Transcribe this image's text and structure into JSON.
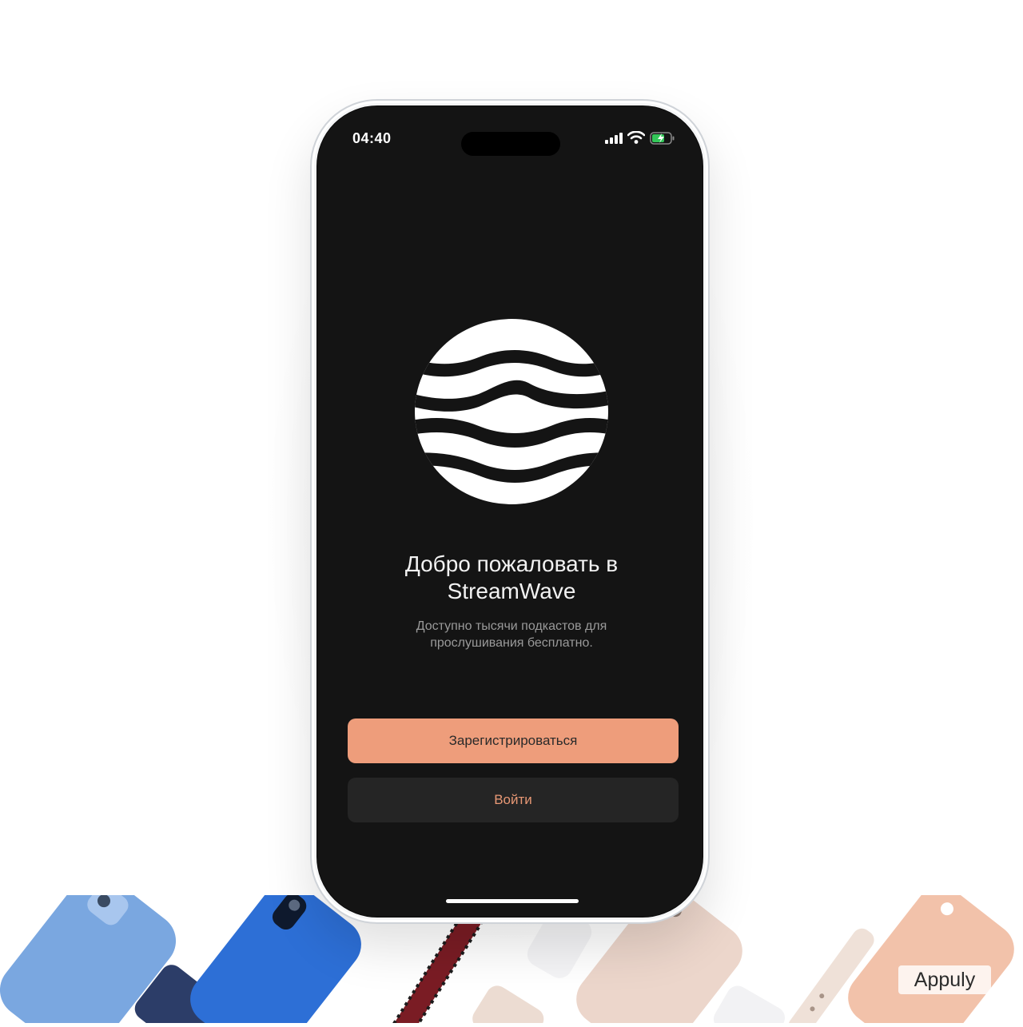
{
  "status_bar": {
    "time": "04:40"
  },
  "welcome": {
    "title_line1": "Добро пожаловать в",
    "title_line2": "StreamWave",
    "subtitle_line1": "Доступно тысячи подкастов для",
    "subtitle_line2": "прослушивания бесплатно."
  },
  "buttons": {
    "register": "Зарегистрироваться",
    "login": "Войти"
  },
  "colors": {
    "screen_bg": "#141414",
    "primary_button": "#ee9d7b",
    "secondary_button": "#252525",
    "secondary_text": "#e89875",
    "battery_charging": "#34c759"
  },
  "icons": [
    "cellular-signal-icon",
    "wifi-icon",
    "battery-charging-icon",
    "streamwave-logo"
  ],
  "watermark": "Appuly"
}
